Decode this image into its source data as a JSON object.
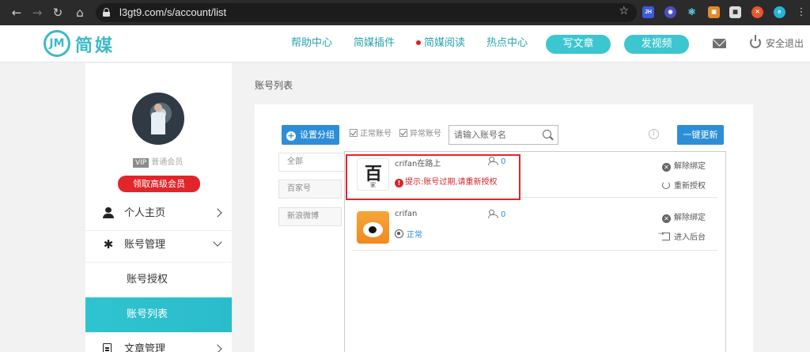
{
  "browser": {
    "url": "l3gt9.com/s/account/list",
    "extensions": [
      {
        "name": "jh-extension-icon",
        "label": "JH",
        "color": "#3b5bd9"
      },
      {
        "name": "extension-icon-2",
        "label": "",
        "color": "#4a4fc4"
      },
      {
        "name": "react-devtools-icon",
        "label": "",
        "color": "#2d2d2d"
      },
      {
        "name": "extension-icon-4",
        "label": "",
        "color": "#e08a2c"
      },
      {
        "name": "qr-code-icon",
        "label": "",
        "color": "#dddddd"
      },
      {
        "name": "extension-icon-6",
        "label": "",
        "color": "#e8572a"
      },
      {
        "name": "extension-icon-7",
        "label": "",
        "color": "#24b5d8"
      }
    ]
  },
  "header": {
    "logo_mark": "JM",
    "logo_text": "简媒",
    "nav": [
      "帮助中心",
      "简媒插件",
      "简媒阅读",
      "热点中心"
    ],
    "write_article": "写文章",
    "post_video": "发视频",
    "logout": "安全退出",
    "accent": "#3dbac7"
  },
  "sidebar": {
    "vip_badge": "VIP",
    "member_level": "普通会员",
    "upgrade": "领取高级会员",
    "menu": {
      "home": "个人主页",
      "account_mgmt": "账号管理",
      "account_auth": "账号授权",
      "account_list": "账号列表",
      "article_mgmt": "文章管理"
    }
  },
  "main": {
    "page_title": "账号列表",
    "toolbar": {
      "add_group": "设置分组",
      "normal_accounts": "正常账号",
      "abnormal_accounts": "异常账号",
      "search_placeholder": "请输入账号名",
      "refresh_all": "一键更新"
    },
    "groups": [
      "全部",
      "百家号",
      "新浪微博"
    ],
    "accounts": [
      {
        "platform": "baidu",
        "thumb_glyph": "百",
        "thumb_sub": "家",
        "name": "crifan在路上",
        "fans": "0",
        "status": "提示:账号过期,请重新授权",
        "status_type": "error",
        "action1": "解除绑定",
        "action2": "重新授权"
      },
      {
        "platform": "weibo",
        "name": "crifan",
        "fans": "0",
        "status": "正常",
        "status_type": "ok",
        "action1": "解除绑定",
        "action2": "进入后台"
      }
    ]
  }
}
